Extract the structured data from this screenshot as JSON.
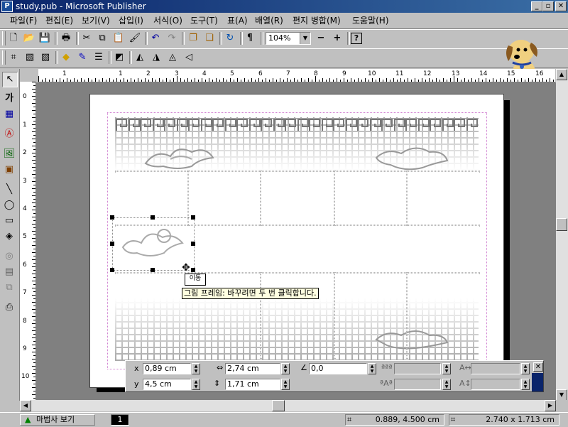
{
  "window": {
    "title": "study.pub - Microsoft Publisher",
    "app_icon": "publisher-icon",
    "min_label": "_",
    "max_label": "▫",
    "close_label": "✕"
  },
  "menu": [
    {
      "label": "파일(F)"
    },
    {
      "label": "편집(E)"
    },
    {
      "label": "보기(V)"
    },
    {
      "label": "삽입(I)"
    },
    {
      "label": "서식(O)"
    },
    {
      "label": "도구(T)"
    },
    {
      "label": "표(A)"
    },
    {
      "label": "배열(R)"
    },
    {
      "label": "편지 병합(M)"
    },
    {
      "label": "도움말(H)"
    }
  ],
  "standard_toolbar": {
    "zoom": "104%",
    "zoom_out": "−",
    "zoom_in": "+",
    "help": "?"
  },
  "ruler": {
    "h_numbers": [
      "1",
      "1",
      "2",
      "3",
      "4",
      "5",
      "6",
      "7",
      "8",
      "9",
      "10",
      "11",
      "12",
      "13",
      "14",
      "15",
      "16"
    ],
    "v_numbers": [
      "0",
      "1",
      "2",
      "3",
      "4",
      "5",
      "6",
      "7",
      "8",
      "9",
      "10"
    ]
  },
  "toolbox": {
    "text_tool_label": "가"
  },
  "canvas": {
    "tooltip": "그림 프레임: 바꾸려면 두 번 클릭합니다.",
    "move_label": "이동"
  },
  "measurements": {
    "x_label": "x",
    "x_value": "0,89 cm",
    "y_label": "y",
    "y_value": "4,5 cm",
    "width_value": "2,74 cm",
    "height_value": "1,71 cm",
    "rotation_value": "0,0"
  },
  "statusbar": {
    "wizard_label": "마법사 보기",
    "page_number": "1",
    "position": "0.889, 4.500 cm",
    "size": "2.740 x 1.713 cm"
  },
  "colors": {
    "titlebar": "#0a246a",
    "face": "#c0c0c0",
    "workspace": "#808080"
  }
}
